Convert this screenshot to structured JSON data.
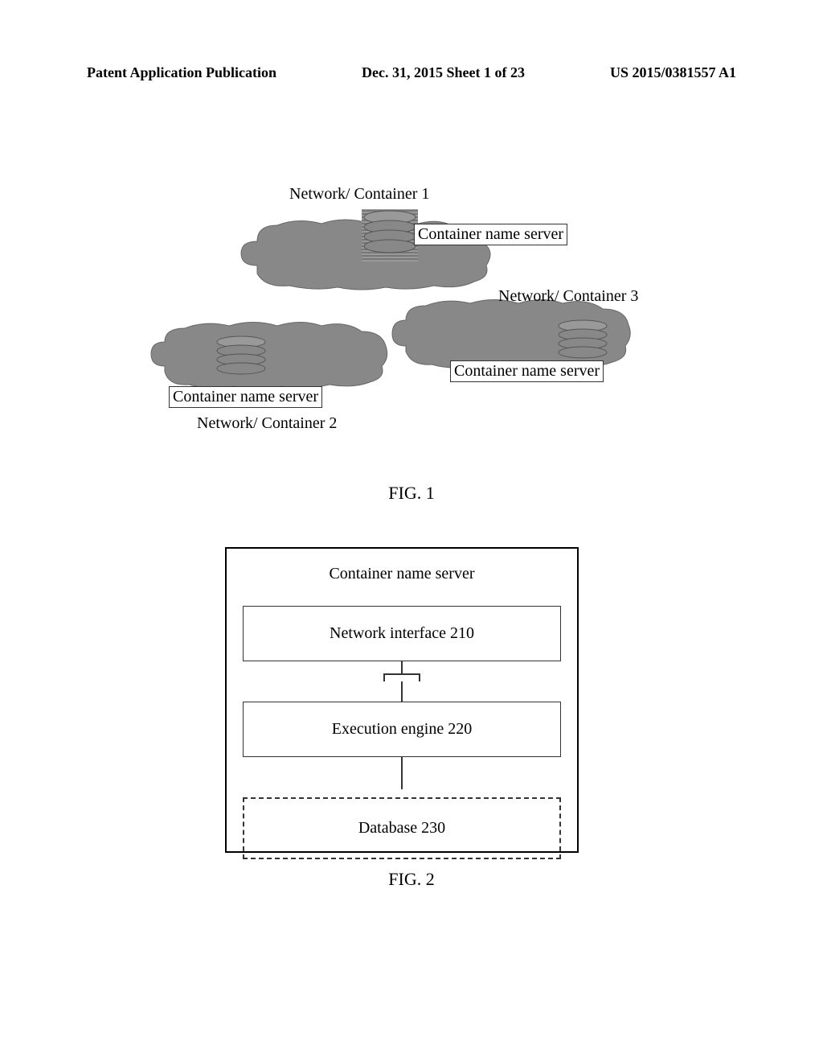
{
  "header": {
    "left": "Patent Application Publication",
    "center": "Dec. 31, 2015  Sheet 1 of 23",
    "right": "US 2015/0381557 A1"
  },
  "fig1": {
    "caption": "FIG. 1",
    "cloud1_label": "Network/ Container 1",
    "cloud1_server": "Container name server",
    "cloud2_label": "Network/ Container 2",
    "cloud2_server": "Container name server",
    "cloud3_label": "Network/ Container 3",
    "cloud3_server": "Container name server"
  },
  "fig2": {
    "caption": "FIG. 2",
    "title": "Container name server",
    "box1": "Network interface 210",
    "box2": "Execution engine 220",
    "box3": "Database 230"
  }
}
